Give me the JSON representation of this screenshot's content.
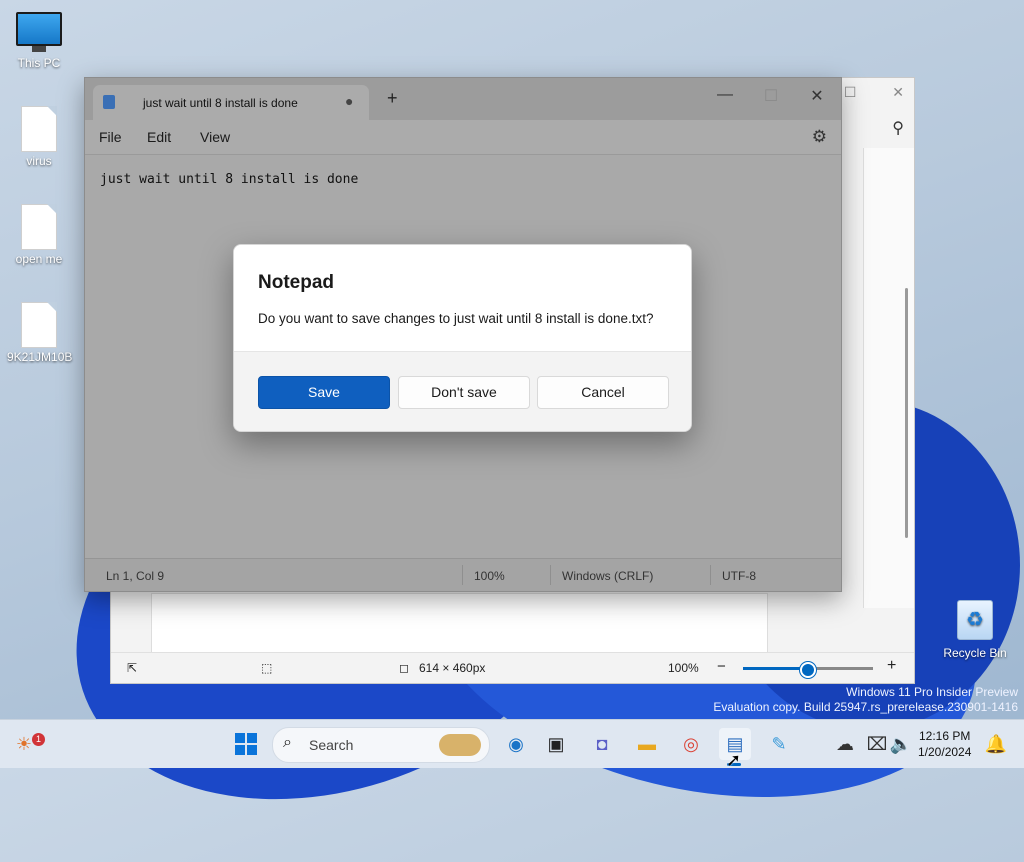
{
  "desktop": {
    "icons": [
      {
        "label": "This PC",
        "icon": "monitor-icon"
      },
      {
        "label": "virus",
        "icon": "file-icon"
      },
      {
        "label": "open me",
        "icon": "file-icon"
      },
      {
        "label": "9K21JM10B",
        "icon": "file-icon"
      },
      {
        "label": "Recycle Bin",
        "icon": "recycle-bin-icon"
      }
    ],
    "watermark": {
      "line1": "Windows 11 Pro Insider Preview",
      "line2": "Evaluation copy. Build 25947.rs_prerelease.230901-1416"
    }
  },
  "paint": {
    "status": {
      "dimensions": "614 × 460px",
      "zoom": "100%",
      "zoom_level": 0.5,
      "minus": "−",
      "plus": "+"
    }
  },
  "notepad": {
    "tab_title": "just wait until 8 install is done",
    "unsaved_dot": "●",
    "new_tab": "+",
    "menu": {
      "file": "File",
      "edit": "Edit",
      "view": "View"
    },
    "content": "just wait until 8 install is done",
    "status": {
      "position": "Ln 1, Col 9",
      "zoom": "100%",
      "line_ending": "Windows (CRLF)",
      "encoding": "UTF-8"
    }
  },
  "dialog": {
    "title": "Notepad",
    "message": "Do you want to save changes to just wait until 8 install is done.txt?",
    "save": "Save",
    "dont_save": "Don't save",
    "cancel": "Cancel"
  },
  "taskbar": {
    "search_label": "Search",
    "widgets_badge": "1",
    "time": "12:16 PM",
    "date": "1/20/2024"
  },
  "colors": {
    "accent": "#0f5fbf",
    "taskbar": "#dfe7f1"
  }
}
